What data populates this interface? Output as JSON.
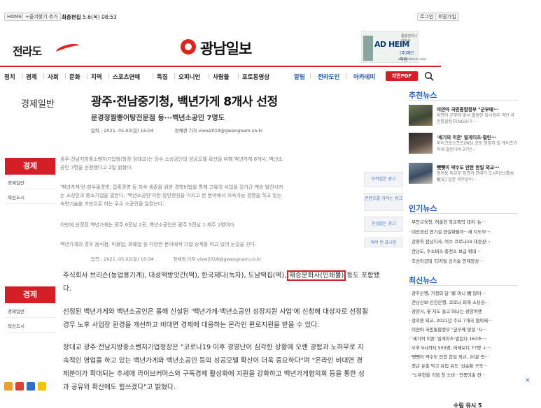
{
  "topbar": {
    "home": "HOME",
    "bookmark": "+즐겨찾기 추가",
    "updated_label": "최종편집",
    "updated_value": "5.6(목) 08:53",
    "login": "로그인",
    "join": "회원가입"
  },
  "header": {
    "left_logo": "전라도",
    "main_logo": "광남일보",
    "ad": {
      "brand": "AD HEIM",
      "top": "종합엔지니어링사",
      "sub": "(주)에드하임",
      "url": "www.adheim.com"
    }
  },
  "nav": {
    "items": [
      "정치",
      "경제",
      "사회",
      "문화",
      "지역",
      "스포츠연예",
      "특집",
      "오피니언",
      "사람들",
      "포토동영상"
    ],
    "right_items": [
      "알림",
      "전라도인",
      "아카데미"
    ],
    "pdf": "지면PDF"
  },
  "article": {
    "category": "경제일반",
    "headline": "광주·전남중기청, 백년가게 8개사 선정",
    "subhead": "문경정짬뽕어탕전문점 등···백년소공인 7명도",
    "date": "입력 : 2021. 05.02(일) 16:04",
    "reporter": "정채경 기자 view2018@gwangnam.co.kr",
    "faded_p1": "광주·전남지방중소벤처기업청(청장 장대교)는 장수 소상공인의 성공모델 확산을 위해 백년가게 8개사, 백년소",
    "faded_p1b": "공인 7명을 선정했다고 2일 밝혔다.",
    "faded_p2": "'백년가게'란 한우물경영, 집중경영 등 지속 생존을 위한 경영비법을 통해 고유의 사업을 장기간 계승 발전시키",
    "faded_p2b": "는 소상인과 중소기업을 말한다. '백년소공인'이란 장인정신을 가지고 한 분야에서 지속가능 경영을 하고 있는",
    "faded_p2c": "숙련기술을 기반으로 하는 우수 소공인을 일컫는다.",
    "faded_p3": "이번에 선정된 백년가게는 광주 6전남 2곳, 백년소공인은 광주 5전남 1·제주 1명이다.",
    "faded_p4": "백년가게의 경우 음식점, 미용업, 화훼업 등 다양한 분야에서 가업 승계를 하고 있어 눈길을 끈다.",
    "date2": "입력 : 2021. 05.02(일) 16:04",
    "reporter2": "정채경 기자 view2018@gwangnam.co.kr",
    "p1_before": "주식회사 브리슨(농업용기계), 대성떡방앗간(떡), 한국제다(녹차), 도남떡집(떡),",
    "p1_highlight": "재승문화사(인쇄물)",
    "p1_after": "등도 포함됐",
    "p1_line2": "다.",
    "p2_line1": "선정된 백년가게와 백년소공인은 올해 신설된 '백년가게·백년소공인 성장지원 사업'에 신청해 대상자로 선정될",
    "p2_line2": "경우 노후 사업장 환경을 개선하고 비대면 경제에 대응하는 온라인 판로지원을 받을 수 있다.",
    "p3_line1": "장대교 광주·전남지방중소벤처기업청장은 \"코로나19 이후 경영난이 심각한 상황에 오랜 경험과 노하우로 지",
    "p3_line2": "속적인 영업을 하고 있는 백년가게와 백년소공인 등의 성공모델 확산이 더욱 중요하다\"며 \"온라인 비대면 경",
    "p3_line3": "제분야가 확대되는 추세에 라이브커머스와 구독경제 활성화에 지원을 강화하고 백년가게협의회 등을 통한 성",
    "p3_line4": "과 공유와 확산에도 힘쓰겠다\"고 밝혔다."
  },
  "left_sections": [
    {
      "head": "경제",
      "links": [
        "경제일반",
        "혁신도시"
      ]
    },
    {
      "head": "경제",
      "links": [
        "경제일반",
        "혁신도시"
      ]
    }
  ],
  "side_ads": [
    "부적절한 광고",
    "콘텐츠를 가리는 광고",
    "관심없는 광고",
    "여러 번 표시된"
  ],
  "right_column": {
    "recommended_title": "추천뉴스",
    "recommended": [
      {
        "title": "미얀마 국민통합정부 \"군부에···",
        "desc": "미얀마 군부에 맞서 출범한 임시정부 격인 국민통합정부(NGU)가 ···"
      },
      {
        "title": "'세기의 이혼' 빌게이츠·멀린···",
        "desc": "마이크로소프트(MS) 공동 창업자 빌 게이츠가 아내 멀린다와 27년···"
      },
      {
        "title": "뺏뺏이 약수도 안한 한일 외교···",
        "desc": "정의용 외교부 장관과 모테기 도시미쓰(茂木敏充) 일본 외무상이···"
      }
    ],
    "popular_title": "인기뉴스",
    "popular": [
      "· 무안교육청, 허술한 학교폭력 대처 '논···",
      "· 대선경선 연기설 현실화될까···새 지도부···",
      "· 강영욱 전남지사, 여수 코로나19 대응상···",
      "· 전남도, 수소버스·충전소 보급 확대 ···",
      "· 조선이공대 '디지털 신기술 인재양성···"
    ],
    "latest_title": "최신뉴스",
    "latest": [
      "· 광주은행, 가정의 달 '家 머니 情 많이···",
      "· 전남신보-신한은행, 코로나 피해 소상공···",
      "· 광양시, 꽃 지도 들고 떠나는 광양여행",
      "· 정의용 외교, 2021년 주요 7개국 협의제···",
      "· 미얀마 국민통합정부 \"군부에 맞설 '시···",
      "· '세기의 이혼' 빌게이츠·멀린다 163조···",
      "· 오후 9시까지 555명, 어제보다 77명 ↓···",
      "· 뺏뺏이 약수도 안한 한일 외교, 20분 만···",
      "· 청년 유출 막고 유입 유도 '선순환 구조···",
      "· \"노무현을 기념 첫 소비···인증미술 전···"
    ],
    "bottom_peek": "수림 유시 5"
  },
  "colors": {
    "brand_red": "#d51f26",
    "section_blue": "#1e5fbf",
    "highlight_border": "#d61f1f"
  }
}
